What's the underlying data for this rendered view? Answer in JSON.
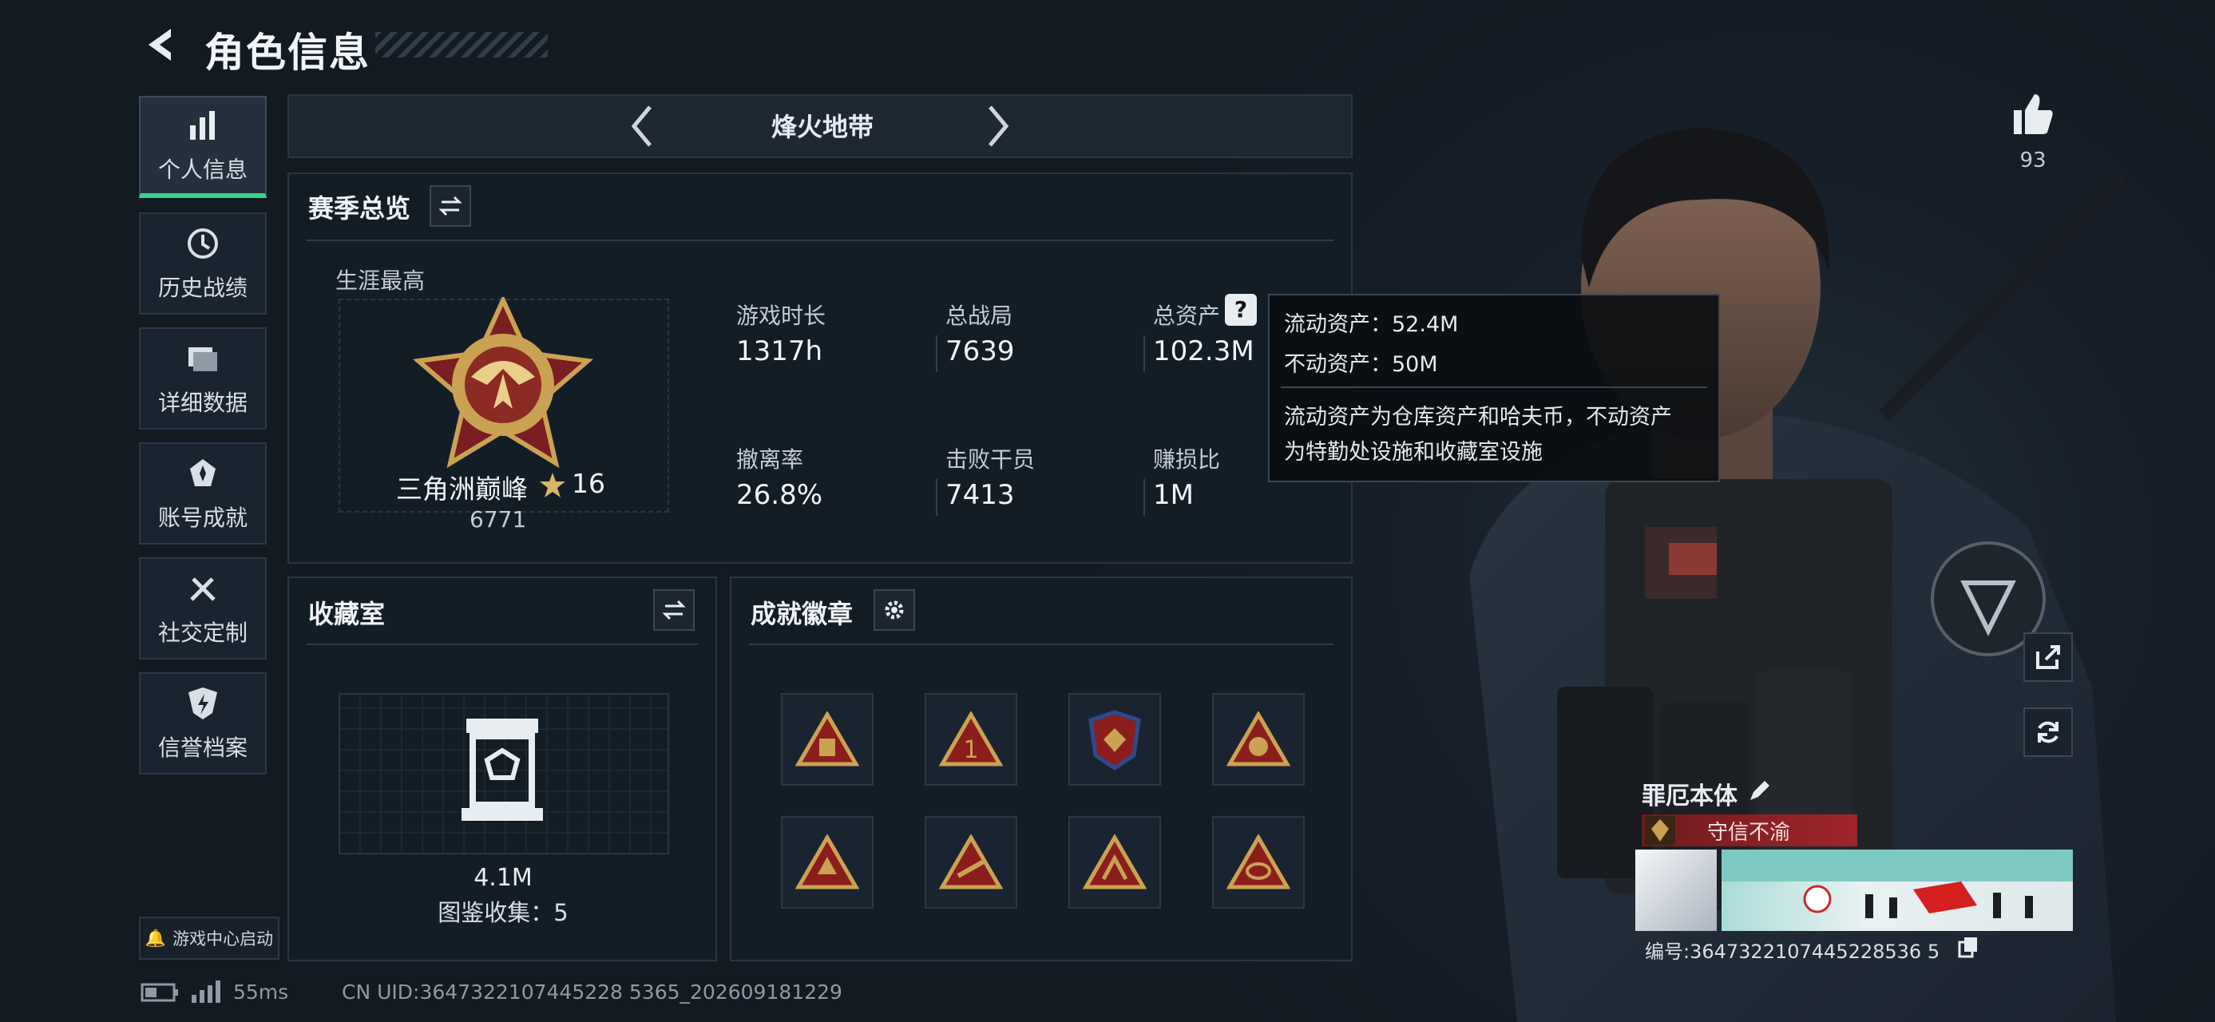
{
  "header": {
    "title": "角色信息"
  },
  "sidebar": {
    "items": [
      {
        "label": "个人信息",
        "icon": "bar-chart-icon",
        "active": true
      },
      {
        "label": "历史战绩",
        "icon": "clock-icon"
      },
      {
        "label": "详细数据",
        "icon": "folder-icon"
      },
      {
        "label": "账号成就",
        "icon": "medal-icon"
      },
      {
        "label": "社交定制",
        "icon": "tools-icon"
      },
      {
        "label": "信誉档案",
        "icon": "shield-icon"
      }
    ],
    "game_center": "游戏中心启动"
  },
  "map": {
    "name": "烽火地带"
  },
  "season": {
    "title": "赛季总览",
    "career_label": "生涯最高",
    "rank_name": "三角洲巅峰",
    "rank_stars": "16",
    "rank_points": "6771",
    "stats": [
      {
        "label": "游戏时长",
        "value": "1317h"
      },
      {
        "label": "总战局",
        "value": "7639"
      },
      {
        "label": "总资产",
        "value": "102.3M"
      },
      {
        "label": "撤离率",
        "value": "26.8%"
      },
      {
        "label": "击败干员",
        "value": "7413"
      },
      {
        "label": "赚损比",
        "value": "1M"
      }
    ]
  },
  "tooltip": {
    "liquid": "流动资产：52.4M",
    "fixed": "不动资产：50M",
    "desc1": "流动资产为仓库资产和哈夫币，不动资产",
    "desc2": "为特勤处设施和收藏室设施"
  },
  "collection": {
    "title": "收藏室",
    "value": "4.1M",
    "count": "图鉴收集：5"
  },
  "achievements": {
    "title": "成就徽章"
  },
  "likes": {
    "count": "93"
  },
  "character": {
    "name": "罪厄本体",
    "title": "守信不渝",
    "serial": "编号:3647322107445228536 5"
  },
  "status": {
    "ping": "55ms",
    "uid": "CN UID:3647322107445228 5365_202609181229"
  },
  "colors": {
    "accent": "#36d38a",
    "title_red": "#8e1f22",
    "gold": "#c9a253"
  }
}
